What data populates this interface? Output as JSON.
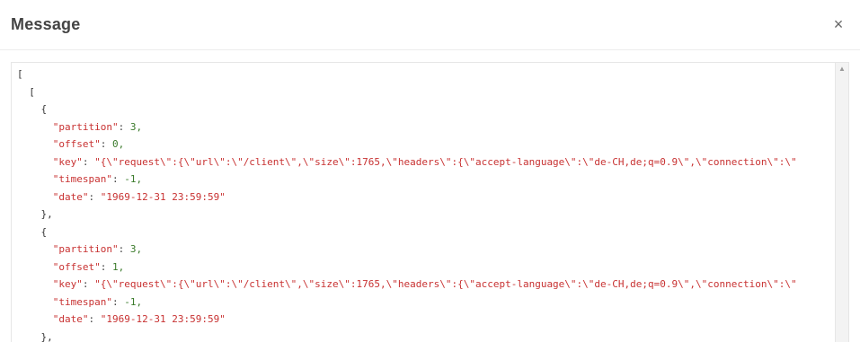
{
  "dialog": {
    "title": "Message",
    "close_glyph": "×",
    "scroll_up_glyph": "▲"
  },
  "message_lines": [
    "[",
    "  [",
    "    {",
    "      \"partition\": 3,",
    "      \"offset\": 0,",
    "      \"key\": \"{\\\"request\\\":{\\\"url\\\":\\\"/client\\\",\\\"size\\\":1765,\\\"headers\\\":{\\\"accept-language\\\":\\\"de-CH,de;q=0.9\\\",\\\"connection\\\":\\\"",
    "      \"timespan\": -1,",
    "      \"date\": \"1969-12-31 23:59:59\"",
    "    },",
    "    {",
    "      \"partition\": 3,",
    "      \"offset\": 1,",
    "      \"key\": \"{\\\"request\\\":{\\\"url\\\":\\\"/client\\\",\\\"size\\\":1765,\\\"headers\\\":{\\\"accept-language\\\":\\\"de-CH,de;q=0.9\\\",\\\"connection\\\":\\\"",
    "      \"timespan\": -1,",
    "      \"date\": \"1969-12-31 23:59:59\"",
    "    },"
  ]
}
